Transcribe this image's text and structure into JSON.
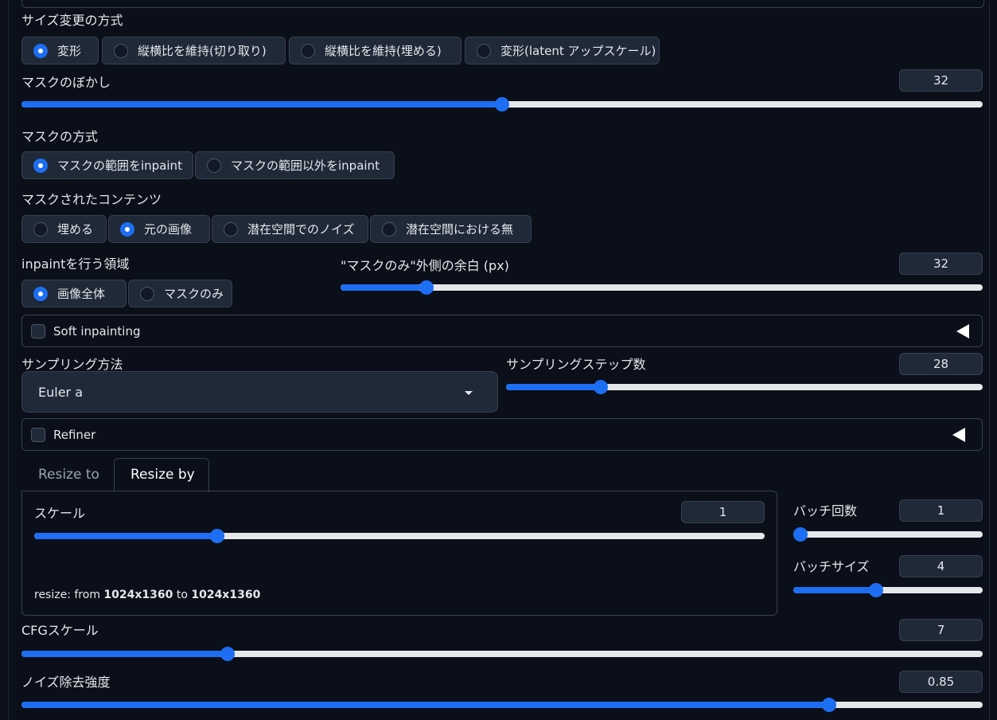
{
  "resize_mode": {
    "label": "サイズ変更の方式",
    "options": [
      "変形",
      "縦横比を維持(切り取り)",
      "縦横比を維持(埋める)",
      "変形(latent アップスケール)"
    ],
    "selected": 0
  },
  "mask_blur": {
    "label": "マスクのぼかし",
    "value": "32",
    "fraction": 0.5
  },
  "mask_mode": {
    "label": "マスクの方式",
    "options": [
      "マスクの範囲をinpaint",
      "マスクの範囲以外をinpaint"
    ],
    "selected": 0
  },
  "masked_content": {
    "label": "マスクされたコンテンツ",
    "options": [
      "埋める",
      "元の画像",
      "潜在空間でのノイズ",
      "潜在空間における無"
    ],
    "selected": 1
  },
  "inpaint_area": {
    "label": "inpaintを行う領域",
    "options": [
      "画像全体",
      "マスクのみ"
    ],
    "selected": 0
  },
  "only_masked_padding": {
    "label": "\"マスクのみ\"外側の余白 (px)",
    "value": "32",
    "fraction": 0.125
  },
  "soft_inpainting": {
    "label": "Soft inpainting",
    "checked": false
  },
  "sampler": {
    "label": "サンプリング方法",
    "value": "Euler a"
  },
  "steps": {
    "label": "サンプリングステップ数",
    "value": "28",
    "fraction": 0.19
  },
  "refiner": {
    "label": "Refiner",
    "checked": false
  },
  "tabs": {
    "items": [
      "Resize to",
      "Resize by"
    ],
    "active": 1
  },
  "scale": {
    "label": "スケール",
    "value": "1",
    "fraction": 0.245
  },
  "resize_info": {
    "prefix": "resize: from ",
    "from": "1024x1360",
    "mid": " to ",
    "to": "1024x1360"
  },
  "batch_count": {
    "label": "バッチ回数",
    "value": "1",
    "fraction": 0.0
  },
  "batch_size": {
    "label": "バッチサイズ",
    "value": "4",
    "fraction": 0.43
  },
  "cfg_scale": {
    "label": "CFGスケール",
    "value": "7",
    "fraction": 0.21
  },
  "denoising": {
    "label": "ノイズ除去強度",
    "value": "0.85",
    "fraction": 0.845
  },
  "colors": {
    "accent": "#1d6ef2",
    "background": "#0b0f19",
    "surface": "#1f2937",
    "border": "#374151"
  }
}
